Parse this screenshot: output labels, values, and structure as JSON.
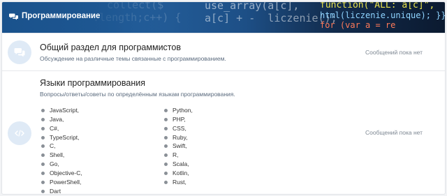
{
  "category": {
    "title": "Программирование",
    "icon": "chat-bubbles-icon"
  },
  "forums": [
    {
      "title": "Общий раздел для программистов",
      "description": "Обсуждение на различные темы связанные с программированием.",
      "stats": "Сообщений пока нет",
      "icon": "comments-icon"
    },
    {
      "title": "Языки программирования",
      "description": "Вопросы/ответы/советы по определённым языкам программирования.",
      "stats": "Сообщений пока нет",
      "icon": "code-icon",
      "languages_col1": [
        "JavaScript,",
        "Java,",
        "C#,",
        "TypeScript,",
        "C,",
        "Shell,",
        "Go,",
        "Objective-C,",
        "PowerShell,",
        "Dart"
      ],
      "languages_col2": [
        "Python,",
        "PHP,",
        "CSS,",
        "Ruby,",
        "Swift,",
        "R,",
        "Scala,",
        "Kotlin,",
        "Rust,"
      ]
    }
  ],
  "colors": {
    "header_bg": "#1f5a96",
    "icon_bg": "#dfeaf6",
    "icon_fg": "#6fa3d8"
  }
}
